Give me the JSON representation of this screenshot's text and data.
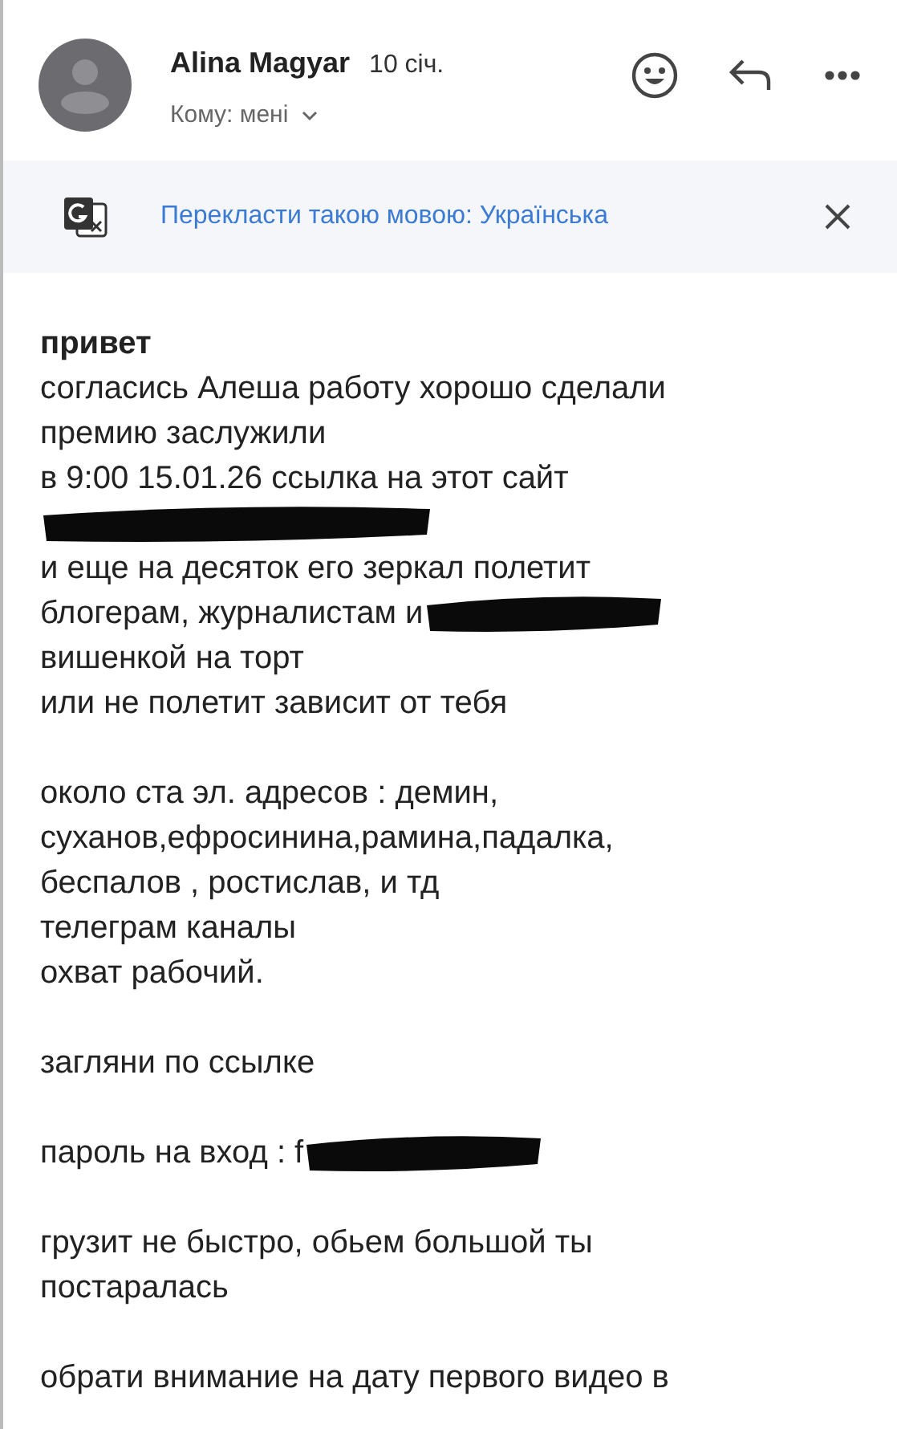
{
  "header": {
    "sender": "Alina Magyar",
    "date": "10 січ.",
    "recipient": "Кому: мені"
  },
  "translate_bar": {
    "label": "Перекласти такою мовою: Українська"
  },
  "body": {
    "greeting": "привет",
    "paragraphs": [
      {
        "lines": [
          {
            "kind": "text",
            "text": "согласись Алеша работу хорошо  сделали"
          },
          {
            "kind": "text",
            "text": "премию заслужили"
          },
          {
            "kind": "text",
            "text": "в 9:00 15.01.26 ссылка на этот сайт"
          },
          {
            "kind": "redacted"
          },
          {
            "kind": "text",
            "text": "и еще на десяток его зеркал полетит"
          },
          {
            "kind": "text-redacted",
            "text": "блогерам, журналистам и"
          },
          {
            "kind": "text",
            "text": "вишенкой на торт"
          },
          {
            "kind": "text",
            "text": "или не полетит зависит от тебя"
          }
        ]
      },
      {
        "lines": [
          {
            "kind": "text",
            "text": "около ста эл. адресов : демин,"
          },
          {
            "kind": "text",
            "text": "суханов,ефросинина,рамина,падалка,"
          },
          {
            "kind": "text",
            "text": "беспалов , ростислав, и тд"
          },
          {
            "kind": "text",
            "text": "телеграм каналы"
          },
          {
            "kind": "text",
            "text": "охват рабочий."
          }
        ]
      },
      {
        "lines": [
          {
            "kind": "text",
            "text": "загляни по ссылке"
          }
        ]
      },
      {
        "lines": [
          {
            "kind": "text-redacted",
            "text": "пароль на вход : f"
          }
        ]
      },
      {
        "lines": [
          {
            "kind": "text",
            "text": "грузит не быстро, обьем большой ты"
          },
          {
            "kind": "text",
            "text": "постаралась"
          }
        ]
      },
      {
        "lines": [
          {
            "kind": "text",
            "text": "обрати внимание на дату первого видео в"
          }
        ]
      }
    ]
  }
}
